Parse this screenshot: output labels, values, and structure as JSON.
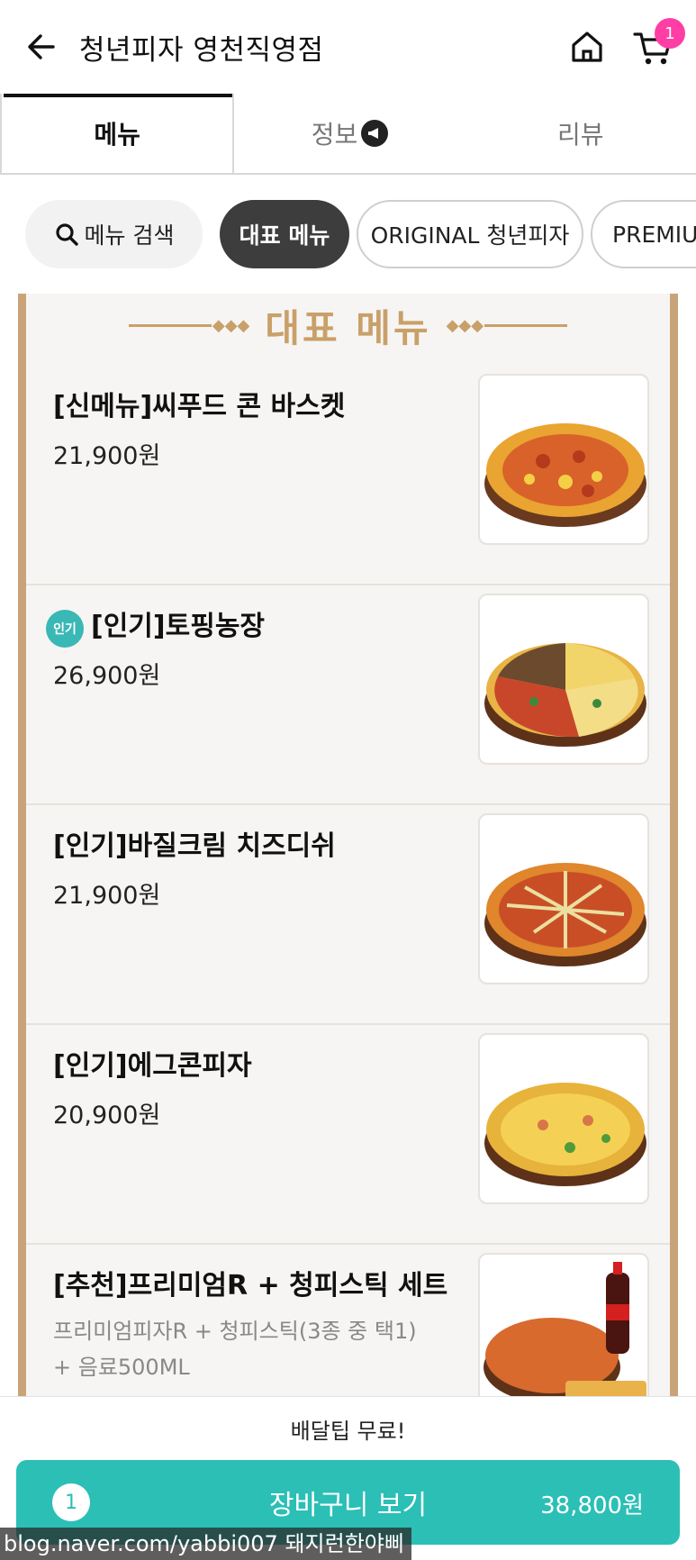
{
  "header": {
    "title": "청년피자 영천직영점",
    "back_icon": "arrow-left-icon",
    "home_icon": "home-icon",
    "cart_icon": "cart-icon",
    "cart_badge": "1",
    "badge_color": "#ff3ea5"
  },
  "tabs": [
    {
      "label": "메뉴",
      "active": true
    },
    {
      "label": "정보",
      "icon": "megaphone-icon"
    },
    {
      "label": "리뷰"
    }
  ],
  "chips": {
    "search_label": "메뉴 검색",
    "search_icon": "search-icon",
    "items": [
      "대표 메뉴",
      "ORIGINAL 청년피자",
      "PREMIUM"
    ]
  },
  "section": {
    "title": "대표 메뉴",
    "accent_color": "#c9a069"
  },
  "menu_items": [
    {
      "name": "[신메뉴]씨푸드 콘 바스켓",
      "price": "21,900원"
    },
    {
      "name": "[인기]토핑농장",
      "price": "26,900원",
      "badge": "인기"
    },
    {
      "name": "[인기]바질크림 치즈디쉬",
      "price": "21,900원"
    },
    {
      "name": "[인기]에그콘피자",
      "price": "20,900원"
    },
    {
      "name": "[추천]프리미엄R + 청피스틱 세트",
      "desc": "프리미엄피자R + 청피스틱(3종 중 택1) + 음료500ML"
    }
  ],
  "bottom": {
    "delivery_tip": "배달팁 무료!",
    "cart_count": "1",
    "cta_label": "장바구니 보기",
    "total": "38,800원",
    "cta_color": "#2bbfb6"
  },
  "watermark": "blog.naver.com/yabbi007 돼지런한야삐"
}
